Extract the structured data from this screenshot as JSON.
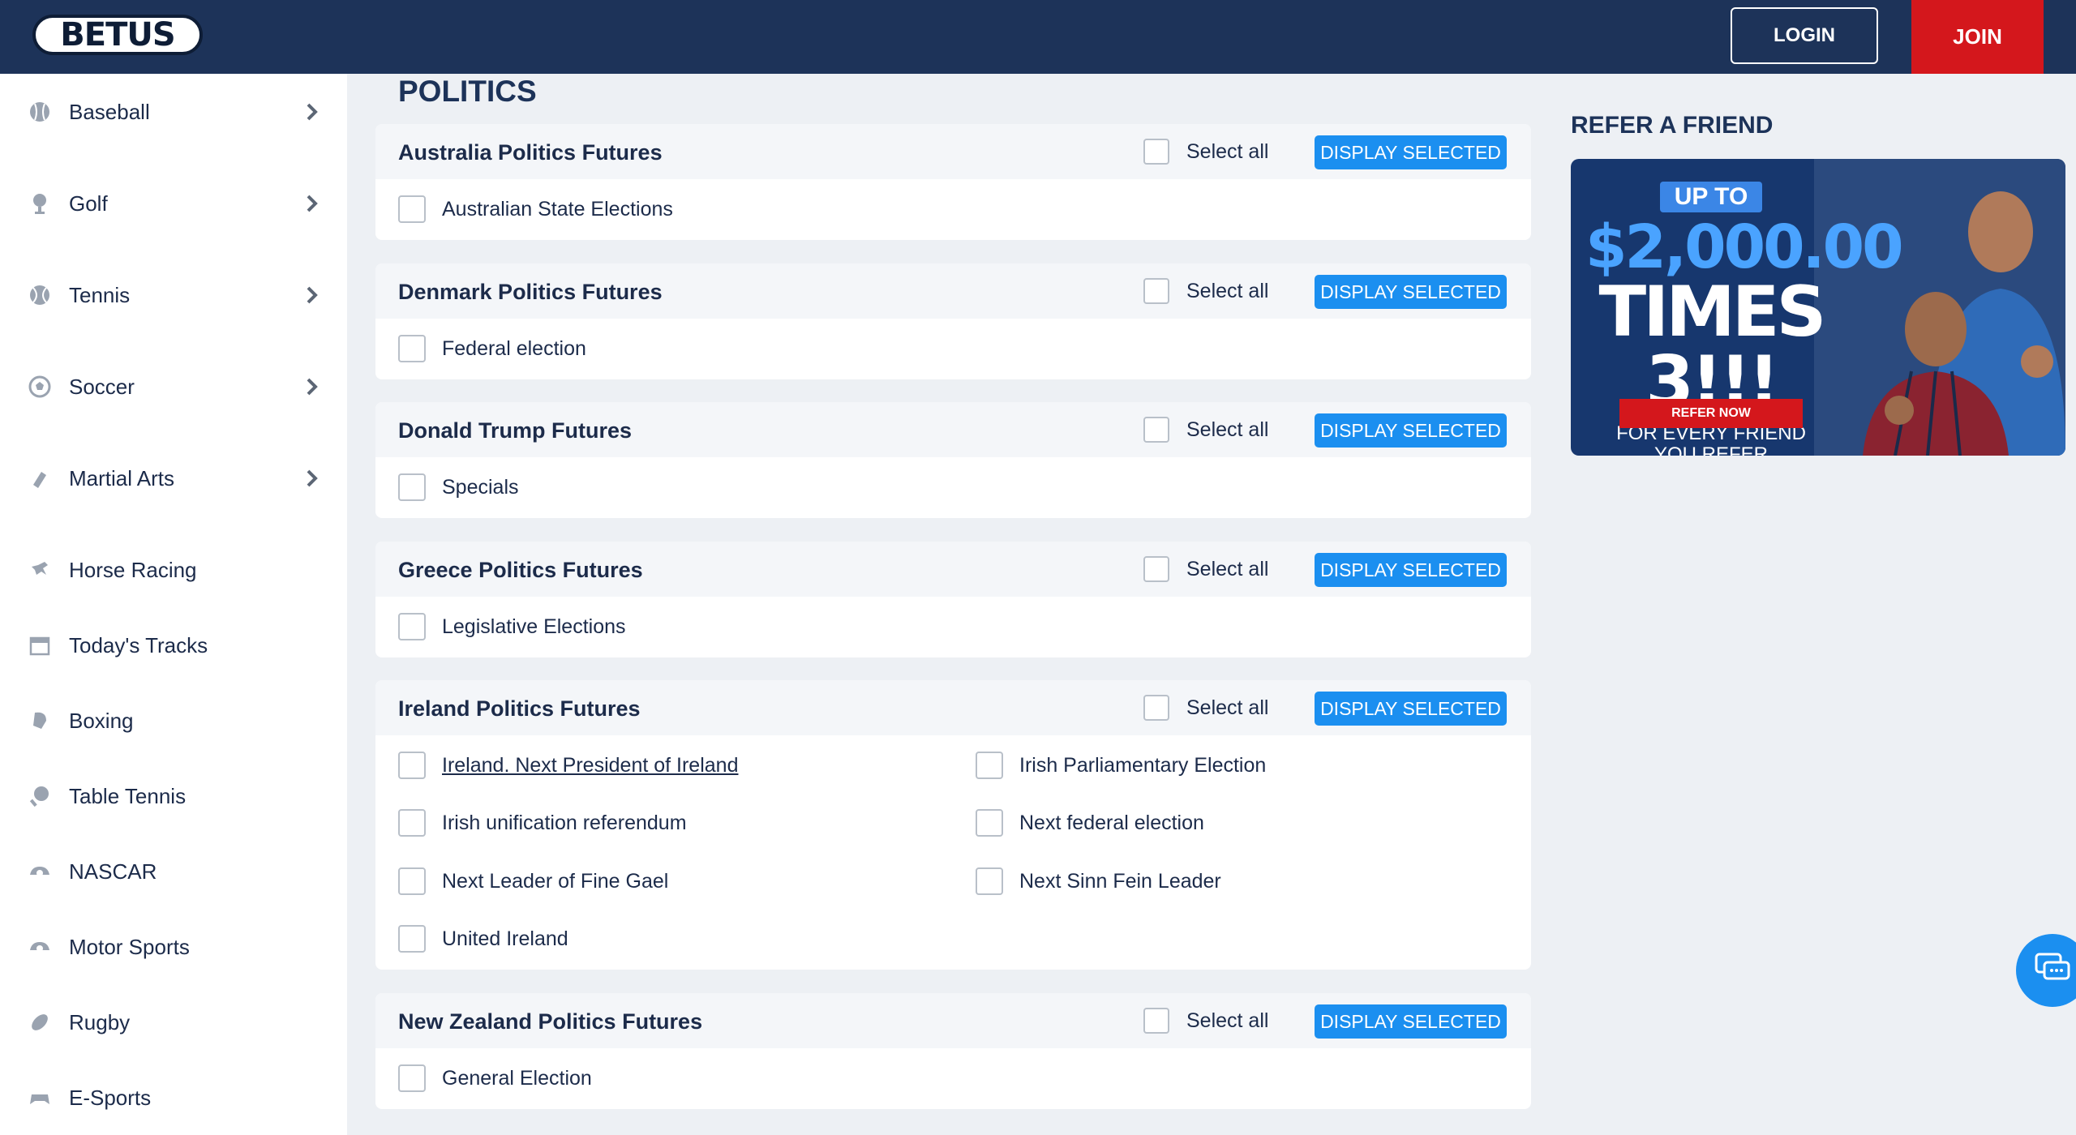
{
  "header": {
    "logo_text": "BETUS",
    "login_label": "LOGIN",
    "join_label": "JOIN"
  },
  "sidebar": {
    "items": [
      {
        "label": "Baseball",
        "icon": "baseball-icon",
        "has_chevron": true
      },
      {
        "label": "Golf",
        "icon": "golf-icon",
        "has_chevron": true
      },
      {
        "label": "Tennis",
        "icon": "tennis-icon",
        "has_chevron": true
      },
      {
        "label": "Soccer",
        "icon": "soccer-icon",
        "has_chevron": true
      },
      {
        "label": "Martial Arts",
        "icon": "martial-arts-icon",
        "has_chevron": true
      },
      {
        "label": "Horse Racing",
        "icon": "horse-racing-icon",
        "has_chevron": false
      },
      {
        "label": "Today's Tracks",
        "icon": "calendar-icon",
        "has_chevron": false
      },
      {
        "label": "Boxing",
        "icon": "boxing-icon",
        "has_chevron": false
      },
      {
        "label": "Table Tennis",
        "icon": "table-tennis-icon",
        "has_chevron": false
      },
      {
        "label": "NASCAR",
        "icon": "nascar-icon",
        "has_chevron": false
      },
      {
        "label": "Motor Sports",
        "icon": "motor-sports-icon",
        "has_chevron": false
      },
      {
        "label": "Rugby",
        "icon": "rugby-icon",
        "has_chevron": false
      },
      {
        "label": "E-Sports",
        "icon": "esports-icon",
        "has_chevron": false
      }
    ]
  },
  "main": {
    "title": "POLITICS",
    "select_all_label": "Select all",
    "display_selected_label": "DISPLAY SELECTED",
    "sections": [
      {
        "title": "Australia Politics Futures",
        "options": [
          "Australian State Elections"
        ]
      },
      {
        "title": "Denmark Politics Futures",
        "options": [
          "Federal election"
        ]
      },
      {
        "title": "Donald Trump Futures",
        "options": [
          "Specials"
        ]
      },
      {
        "title": "Greece Politics Futures",
        "options": [
          "Legislative Elections"
        ]
      },
      {
        "title": "Ireland Politics Futures",
        "options": [
          "Ireland. Next President of Ireland",
          "Irish Parliamentary Election",
          "Irish unification referendum",
          "Next federal election",
          "Next Leader of Fine Gael",
          "Next Sinn Fein Leader",
          "United Ireland"
        ]
      },
      {
        "title": "New Zealand Politics Futures",
        "options": [
          "General Election"
        ]
      }
    ]
  },
  "right": {
    "refer_title": "REFER A FRIEND",
    "promo": {
      "upto": "UP TO",
      "amount": "$2,000.00",
      "times": "TIMES 3!!!",
      "sub1": "FOR EVERY FRIEND",
      "sub2": "YOU REFER",
      "button": "REFER NOW"
    }
  },
  "colors": {
    "header_bg": "#1d3359",
    "join_red": "#d4171c",
    "accent_blue": "#1b8ff0",
    "page_bg": "#edf0f4"
  }
}
